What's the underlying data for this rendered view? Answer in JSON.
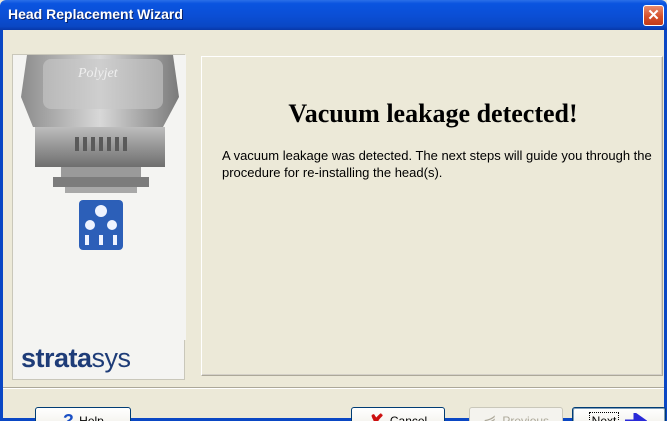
{
  "window": {
    "title": "Head Replacement Wizard",
    "close_glyph": "✕"
  },
  "sidebar": {
    "logo_bold": "strata",
    "logo_light": "sys"
  },
  "content": {
    "heading": "Vacuum leakage detected!",
    "message": "A vacuum leakage was detected. The next steps will guide you through the procedure for re-installing the head(s)."
  },
  "buttons": {
    "help": {
      "icon": "question-icon",
      "prefix": "",
      "underlined": "H",
      "rest": "elp"
    },
    "cancel": {
      "icon": "x-icon",
      "prefix": "",
      "underlined": "C",
      "rest": "ancel"
    },
    "previous": {
      "icon": "back-arrow-icon",
      "prefix": "",
      "underlined": "P",
      "rest": "revious",
      "disabled": true
    },
    "next": {
      "icon": "forward-arrow-icon",
      "prefix": "",
      "underlined": "N",
      "rest": "ext",
      "default": true
    }
  },
  "colors": {
    "titlebar": "#0a54e0",
    "window_bg": "#ece9d8",
    "logo": "#1e3c78",
    "next_arrow": "#2a2ad8"
  }
}
